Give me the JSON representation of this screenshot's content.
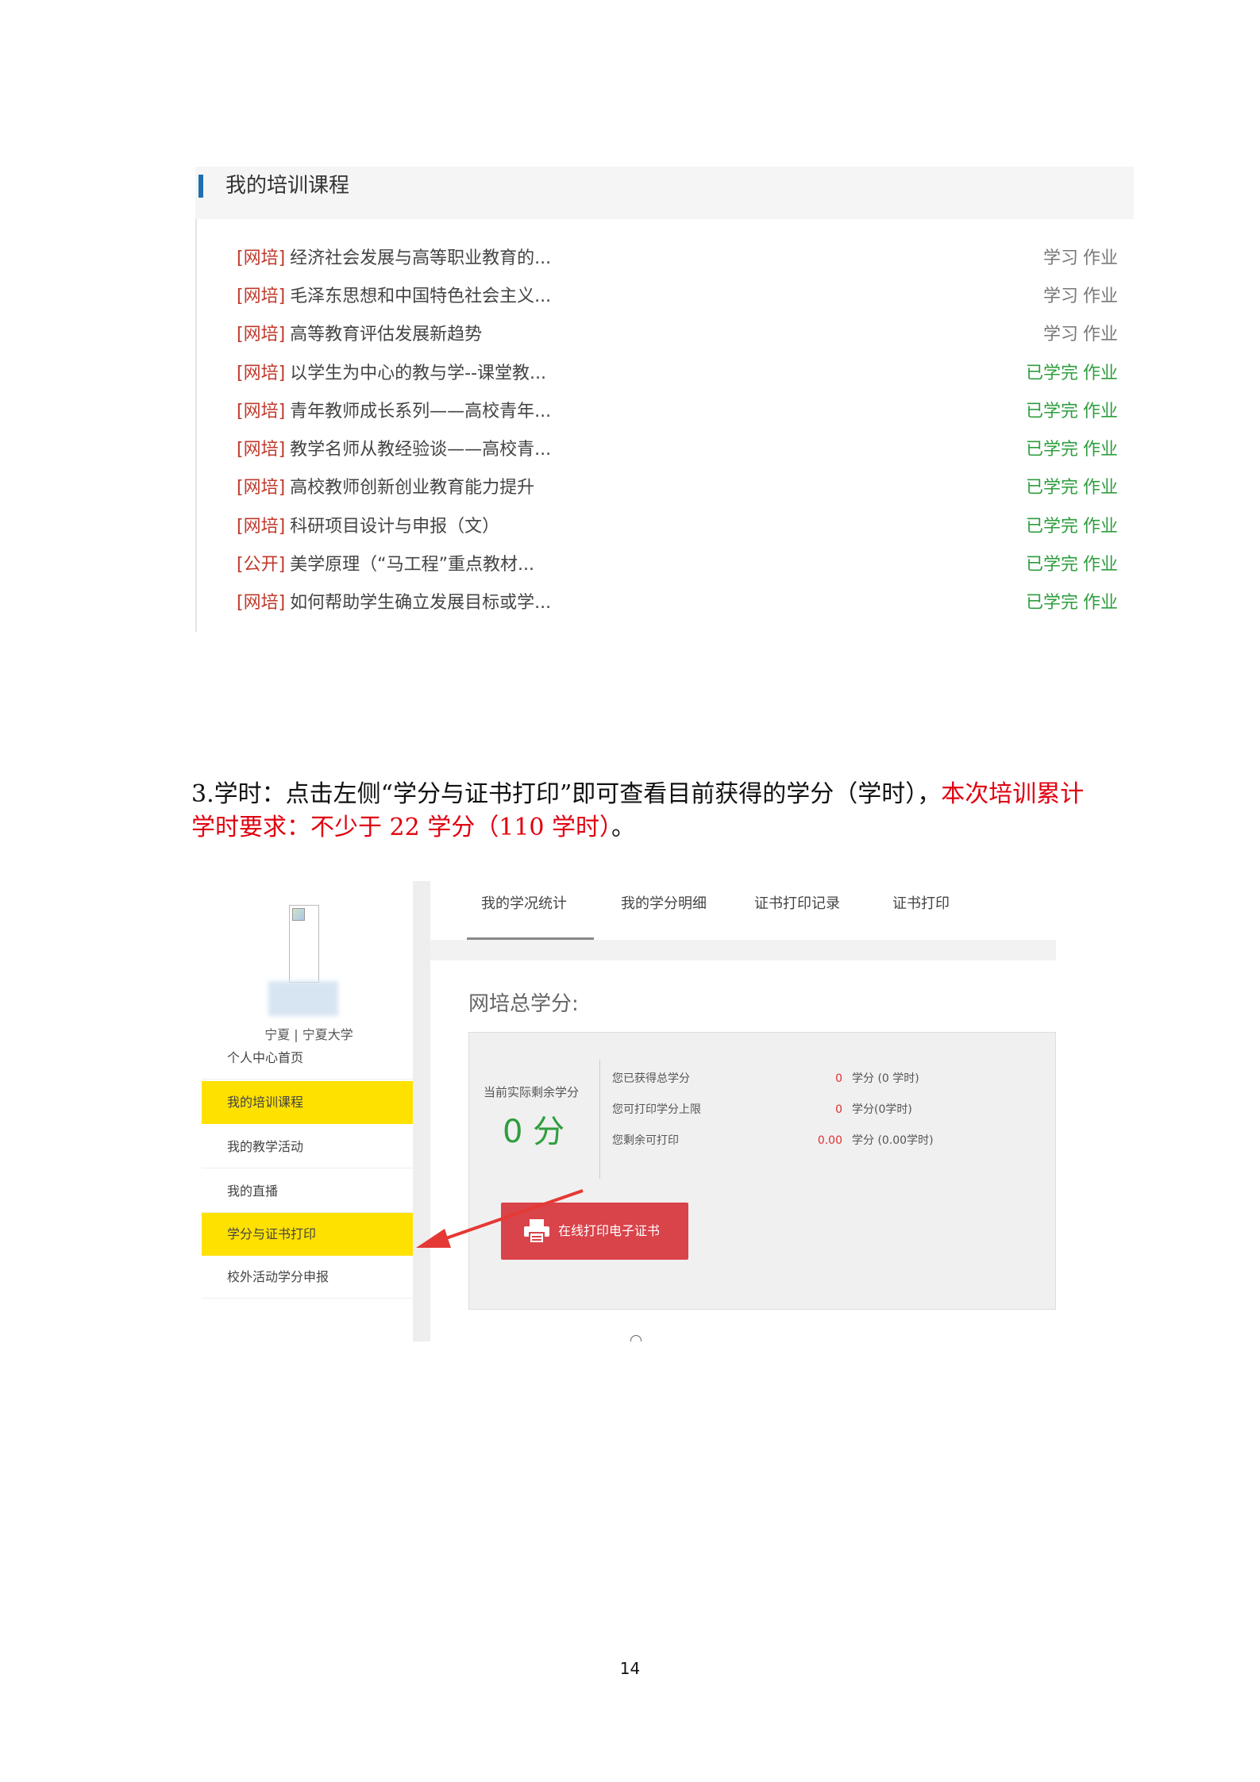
{
  "courses": {
    "title": "我的培训课程",
    "items": [
      {
        "tag": "[网培]",
        "name": "经济社会发展与高等职业教育的...",
        "status": "学习",
        "homework": "作业",
        "done": false
      },
      {
        "tag": "[网培]",
        "name": "毛泽东思想和中国特色社会主义...",
        "status": "学习",
        "homework": "作业",
        "done": false
      },
      {
        "tag": "[网培]",
        "name": "高等教育评估发展新趋势",
        "status": "学习",
        "homework": "作业",
        "done": false
      },
      {
        "tag": "[网培]",
        "name": "以学生为中心的教与学--课堂教...",
        "status": "已学完",
        "homework": "作业",
        "done": true
      },
      {
        "tag": "[网培]",
        "name": "青年教师成长系列——高校青年...",
        "status": "已学完",
        "homework": "作业",
        "done": true
      },
      {
        "tag": "[网培]",
        "name": "教学名师从教经验谈——高校青...",
        "status": "已学完",
        "homework": "作业",
        "done": true
      },
      {
        "tag": "[网培]",
        "name": "高校教师创新创业教育能力提升",
        "status": "已学完",
        "homework": "作业",
        "done": true
      },
      {
        "tag": "[网培]",
        "name": "科研项目设计与申报（文）",
        "status": "已学完",
        "homework": "作业",
        "done": true
      },
      {
        "tag": "[公开]",
        "name": "美学原理（“马工程”重点教材...",
        "status": "已学完",
        "homework": "作业",
        "done": true
      },
      {
        "tag": "[网培]",
        "name": "如何帮助学生确立发展目标或学...",
        "status": "已学完",
        "homework": "作业",
        "done": true
      }
    ]
  },
  "paragraph": {
    "black": "3.学时：点击左侧“学分与证书打印”即可查看目前获得的学分（学时），",
    "red": "本次培训累计学时要求：不少于 22 学分（110 学时）",
    "end": "。"
  },
  "credits": {
    "school": "宁夏 | 宁夏大学",
    "menu": [
      "个人中心首页",
      "我的培训课程",
      "我的教学活动",
      "我的直播",
      "学分与证书打印",
      "校外活动学分申报"
    ],
    "tabs": [
      "我的学况统计",
      "我的学分明细",
      "证书打印记录",
      "证书打印"
    ],
    "heading": "网培总学分:",
    "remaining_label": "当前实际剩余学分",
    "remaining_value": "0 分",
    "stats": [
      {
        "label": "您已获得总学分",
        "num": "0",
        "unit": "学分 (0 学时)"
      },
      {
        "label": "您可打印学分上限",
        "num": "0",
        "unit": "学分(0学时)"
      },
      {
        "label": "您剩余可打印",
        "num": "0.00",
        "unit": "学分 (0.00学时)"
      }
    ],
    "print_button": "在线打印电子证书"
  },
  "page_number": "14",
  "colors": {
    "accent_yellow": "#ffe100",
    "done_green": "#2e9e3e",
    "tag_red": "#c0392b",
    "button_red": "#d9434a",
    "text_red": "#e0000f"
  }
}
